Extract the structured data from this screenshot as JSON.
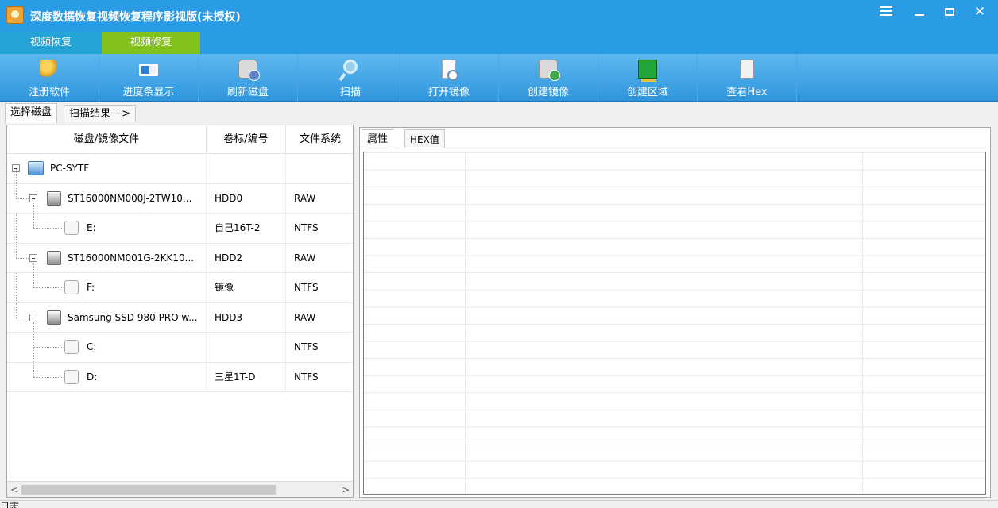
{
  "window": {
    "title": "深度数据恢复视频恢复程序影视版(未授权)",
    "controls": {
      "menu": "menu-icon",
      "minimize": "minimize-icon",
      "maximize": "maximize-icon",
      "close": "✕"
    }
  },
  "menu": {
    "tabs": [
      {
        "label": "视频恢复"
      },
      {
        "label": "视频修复"
      }
    ]
  },
  "toolbar": {
    "items": [
      {
        "label": "注册软件",
        "icon": "key-icon"
      },
      {
        "label": "进度条显示",
        "icon": "progress-icon"
      },
      {
        "label": "刷新磁盘",
        "icon": "disk-refresh-icon"
      },
      {
        "label": "扫描",
        "icon": "scan-icon"
      },
      {
        "label": "打开镜像",
        "icon": "open-image-icon"
      },
      {
        "label": "创建镜像",
        "icon": "create-image-icon"
      },
      {
        "label": "创建区域",
        "icon": "region-icon"
      },
      {
        "label": "查看Hex",
        "icon": "hex-icon"
      }
    ]
  },
  "main_tabs": [
    {
      "label": "选择磁盘"
    },
    {
      "label": "扫描结果--->"
    }
  ],
  "disk_table": {
    "headers": [
      "磁盘/镜像文件",
      "卷标/编号",
      "文件系统"
    ],
    "rows": [
      {
        "name": "PC-SYTF",
        "vol": "",
        "fs": ""
      },
      {
        "name": "ST16000NM000J-2TW10...",
        "vol": "HDD0",
        "fs": "RAW"
      },
      {
        "name": "E:",
        "vol": "自己16T-2",
        "fs": "NTFS"
      },
      {
        "name": "ST16000NM001G-2KK10...",
        "vol": "HDD2",
        "fs": "RAW"
      },
      {
        "name": "F:",
        "vol": "镜像",
        "fs": "NTFS"
      },
      {
        "name": "Samsung SSD 980 PRO w...",
        "vol": "HDD3",
        "fs": "RAW"
      },
      {
        "name": "C:",
        "vol": "",
        "fs": "NTFS"
      },
      {
        "name": "D:",
        "vol": "三星1T-D",
        "fs": "NTFS"
      }
    ],
    "scroll": {
      "left": "<",
      "right": ">"
    }
  },
  "right_tabs": [
    {
      "label": "属性"
    },
    {
      "label": "HEX值"
    }
  ],
  "log": {
    "label": "日志"
  }
}
